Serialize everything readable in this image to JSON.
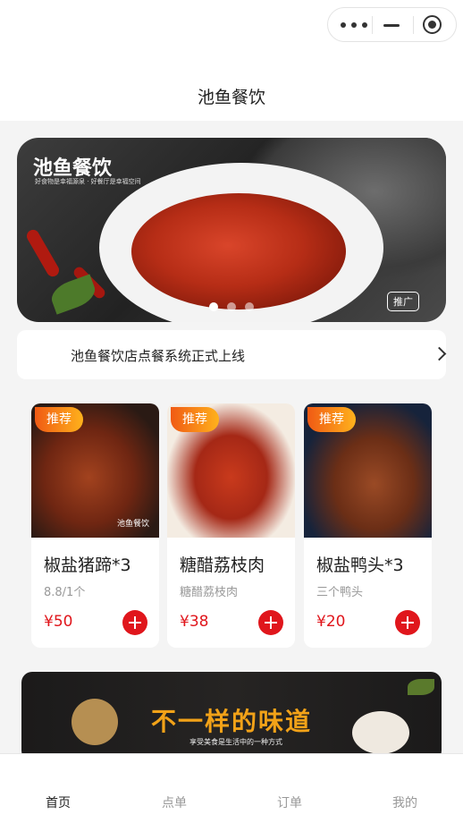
{
  "header": {
    "title": "池鱼餐饮",
    "capsule": {
      "more_icon": "more-dots-icon",
      "minimize_icon": "minimize-icon",
      "close_icon": "record-target-icon"
    }
  },
  "banner": {
    "brand": "池鱼餐饮",
    "slogan": "好食物是幸福源泉 · 好餐厅是幸福空间",
    "ad_label": "推广",
    "slide_count": 3,
    "active_slide": 1
  },
  "notice": {
    "text": "池鱼餐饮店点餐系统正式上线",
    "chevron_icon": "chevron-right-icon"
  },
  "products": [
    {
      "badge": "推荐",
      "name": "椒盐猪蹄*3",
      "desc": "8.8/1个",
      "price": "¥50",
      "image_caption": "池鱼餐饮"
    },
    {
      "badge": "推荐",
      "name": "糖醋荔枝肉",
      "desc": "糖醋荔枝肉",
      "price": "¥38",
      "image_caption": ""
    },
    {
      "badge": "推荐",
      "name": "椒盐鸭头*3",
      "desc": "三个鸭头",
      "price": "¥20",
      "image_caption": ""
    }
  ],
  "promo": {
    "slogan": "不一样的味道",
    "subtitle": "享受美食是生活中的一种方式"
  },
  "tabbar": {
    "active": "首页",
    "tabs": [
      "首页",
      "点单",
      "订单",
      "我的"
    ]
  },
  "colors": {
    "accent": "#e0161c",
    "badge_start": "#f05a14",
    "badge_end": "#ffb21c",
    "page_bg": "#f4f4f4"
  }
}
